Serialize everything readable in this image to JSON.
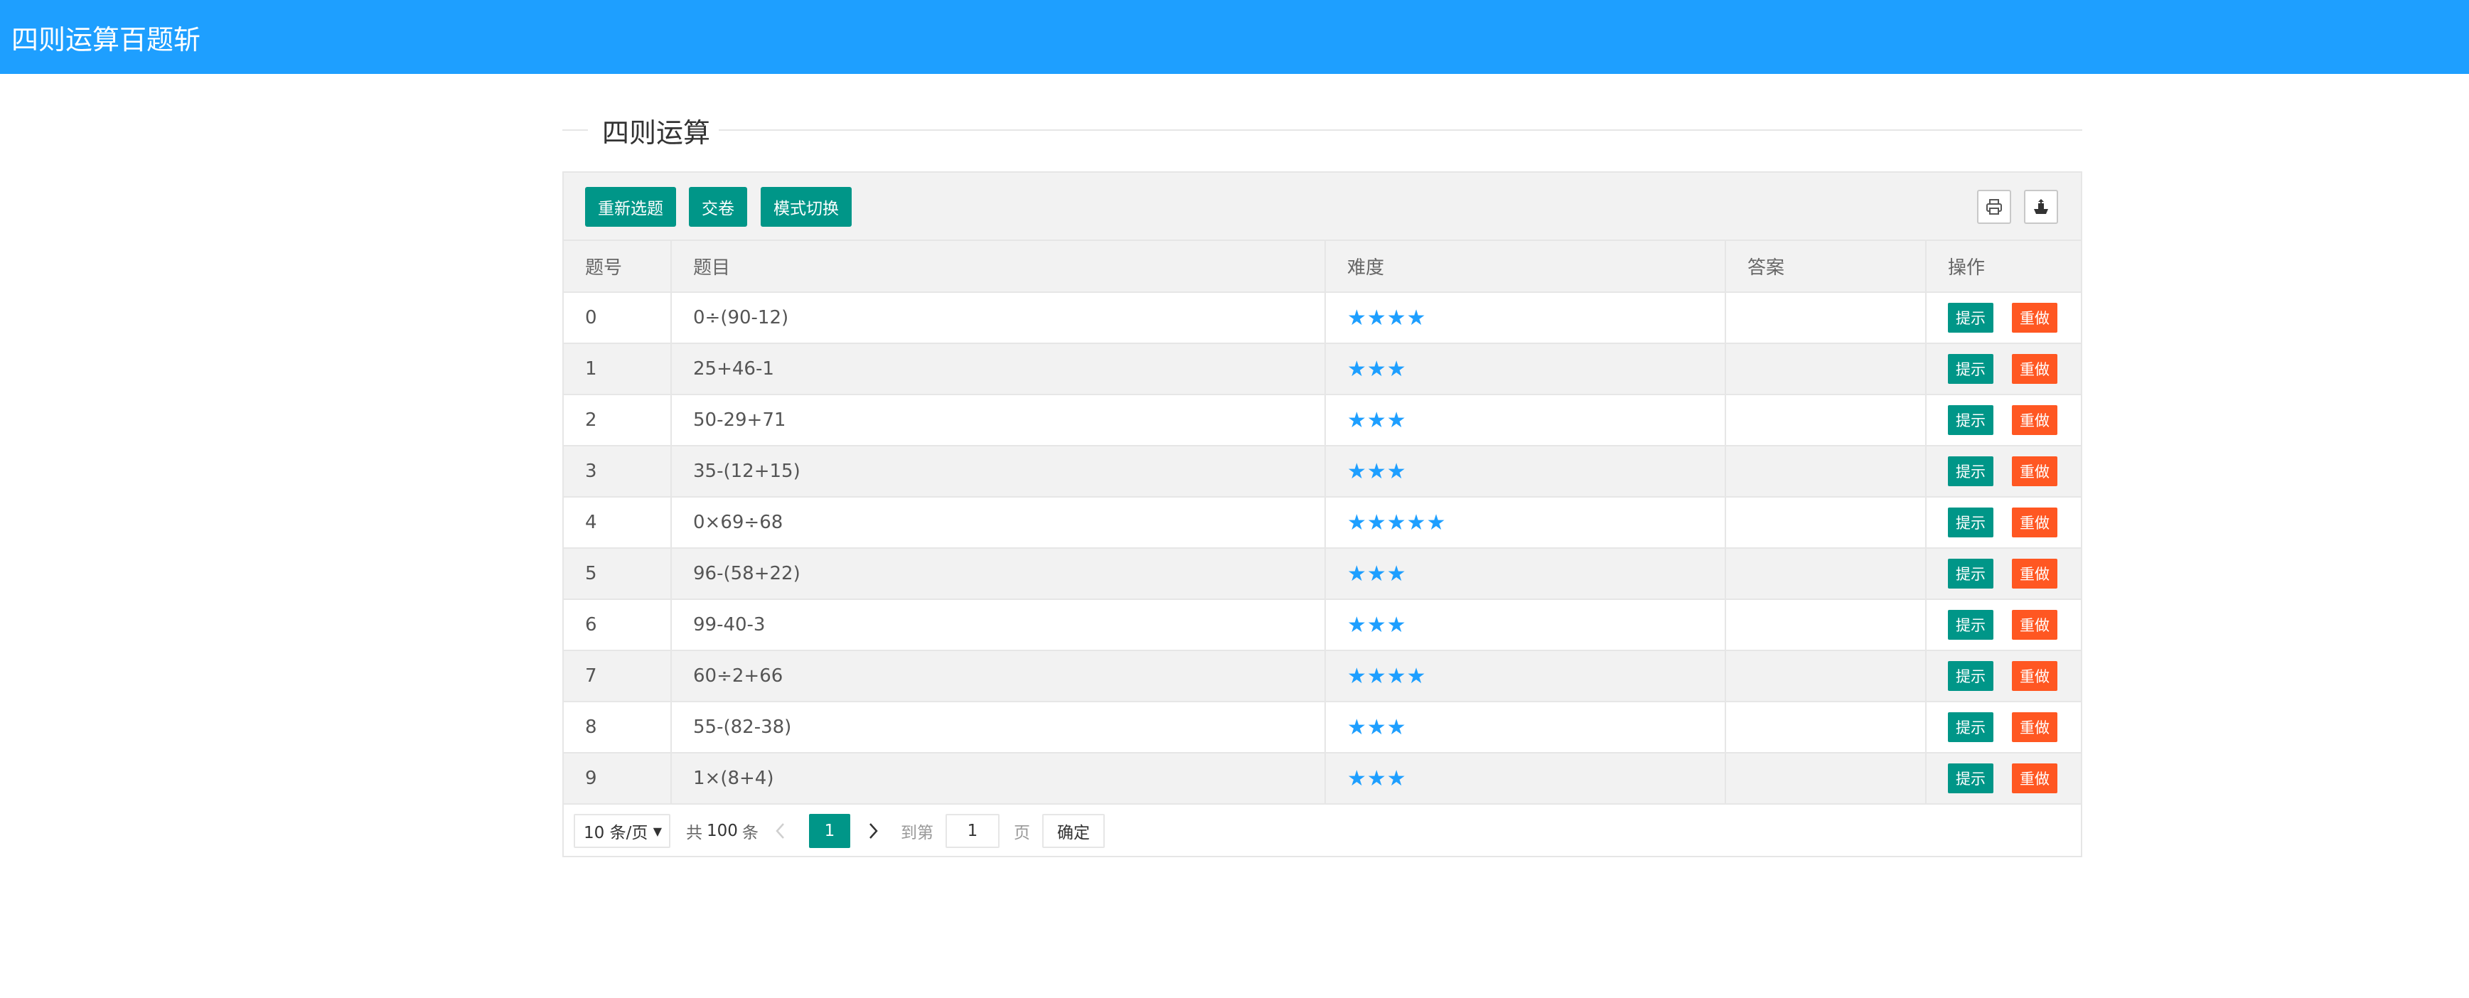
{
  "app": {
    "title": "四则运算百题斩"
  },
  "section": {
    "title": "四则运算"
  },
  "toolbar": {
    "reselect_label": "重新选题",
    "submit_label": "交卷",
    "mode_label": "模式切换",
    "right_icons": [
      "print-icon",
      "export-icon"
    ]
  },
  "table": {
    "columns": [
      "题号",
      "题目",
      "难度",
      "答案",
      "操作"
    ],
    "rows": [
      {
        "no": "0",
        "question": "0÷(90-12)",
        "stars": "★★★★",
        "difficulty": 4,
        "answer": "",
        "hint": "提示",
        "redo": "重做"
      },
      {
        "no": "1",
        "question": "25+46-1",
        "stars": "★★★",
        "difficulty": 3,
        "answer": "",
        "hint": "提示",
        "redo": "重做"
      },
      {
        "no": "2",
        "question": "50-29+71",
        "stars": "★★★",
        "difficulty": 3,
        "answer": "",
        "hint": "提示",
        "redo": "重做"
      },
      {
        "no": "3",
        "question": "35-(12+15)",
        "stars": "★★★",
        "difficulty": 3,
        "answer": "",
        "hint": "提示",
        "redo": "重做"
      },
      {
        "no": "4",
        "question": "0×69÷68",
        "stars": "★★★★★",
        "difficulty": 5,
        "answer": "",
        "hint": "提示",
        "redo": "重做"
      },
      {
        "no": "5",
        "question": "96-(58+22)",
        "stars": "★★★",
        "difficulty": 3,
        "answer": "",
        "hint": "提示",
        "redo": "重做"
      },
      {
        "no": "6",
        "question": "99-40-3",
        "stars": "★★★",
        "difficulty": 3,
        "answer": "",
        "hint": "提示",
        "redo": "重做"
      },
      {
        "no": "7",
        "question": "60÷2+66",
        "stars": "★★★★",
        "difficulty": 4,
        "answer": "",
        "hint": "提示",
        "redo": "重做"
      },
      {
        "no": "8",
        "question": "55-(82-38)",
        "stars": "★★★",
        "difficulty": 3,
        "answer": "",
        "hint": "提示",
        "redo": "重做"
      },
      {
        "no": "9",
        "question": "1×(8+4)",
        "stars": "★★★",
        "difficulty": 3,
        "answer": "",
        "hint": "提示",
        "redo": "重做"
      }
    ]
  },
  "pager": {
    "page_size": "10 条/页",
    "total_prefix": "共",
    "total": "100",
    "total_suffix": "条",
    "prev": "<",
    "current": "1",
    "next": ">",
    "goto_label": "到第",
    "goto_value": "1",
    "page_label": "页",
    "confirm_label": "确定"
  },
  "colors": {
    "header": "#1e9fff",
    "primary": "#009688",
    "danger": "#ff5722",
    "star": "#1e9fff"
  }
}
